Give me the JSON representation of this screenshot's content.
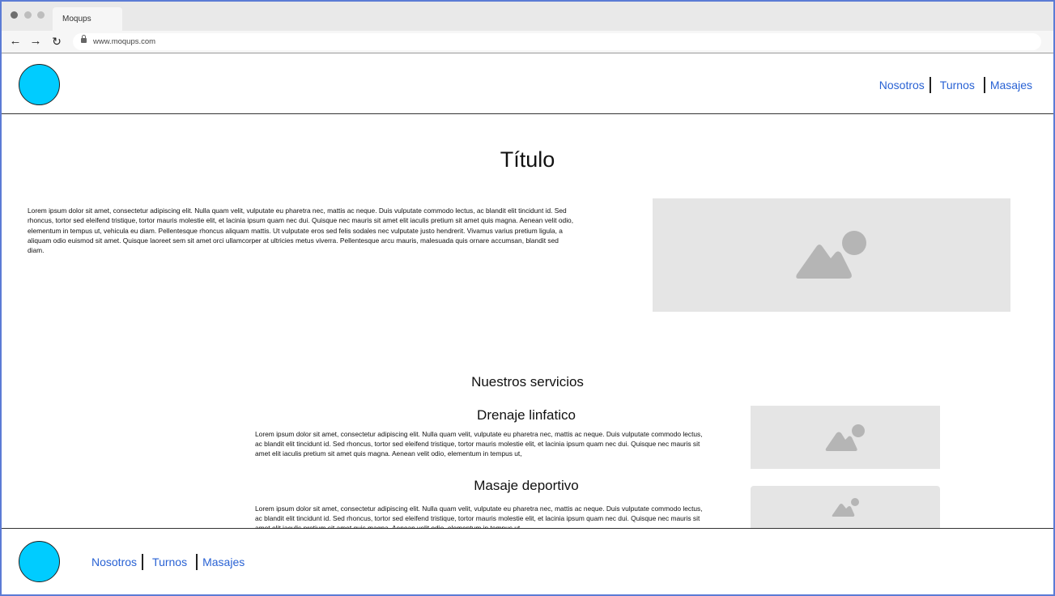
{
  "browser": {
    "tab_title": "Moqups",
    "url": "www.moqups.com"
  },
  "header": {
    "nav": [
      "Nosotros",
      "Turnos",
      "Masajes"
    ]
  },
  "main": {
    "title": "Título",
    "intro_text": "Lorem ipsum dolor sit amet, consectetur adipiscing elit. Nulla quam velit, vulputate eu pharetra nec, mattis ac neque. Duis vulputate commodo lectus, ac blandit elit tincidunt id. Sed rhoncus, tortor sed eleifend tristique, tortor mauris molestie elit, et lacinia ipsum quam nec dui. Quisque nec mauris sit amet elit iaculis pretium sit amet quis magna. Aenean velit odio, elementum in tempus ut, vehicula eu diam. Pellentesque rhoncus aliquam mattis. Ut vulputate eros sed felis sodales nec vulputate justo hendrerit. Vivamus varius pretium ligula, a aliquam odio euismod sit amet. Quisque laoreet sem sit amet orci ullamcorper at ultricies metus viverra. Pellentesque arcu mauris, malesuada quis ornare accumsan, blandit sed diam.",
    "services_heading": "Nuestros servicios",
    "services": [
      {
        "title": "Drenaje linfatico",
        "text": "Lorem ipsum dolor sit amet, consectetur adipiscing elit. Nulla quam velit, vulputate eu pharetra nec, mattis ac neque. Duis vulputate commodo lectus, ac blandit elit tincidunt id. Sed rhoncus, tortor sed eleifend tristique, tortor mauris molestie elit, et lacinia ipsum quam nec dui. Quisque nec mauris sit amet elit iaculis pretium sit amet quis magna. Aenean velit odio, elementum in tempus ut,"
      },
      {
        "title": "Masaje deportivo",
        "text": "Lorem ipsum dolor sit amet, consectetur adipiscing elit. Nulla quam velit, vulputate eu pharetra nec, mattis ac neque. Duis vulputate commodo lectus, ac blandit elit tincidunt id. Sed rhoncus, tortor sed eleifend tristique, tortor mauris molestie elit, et lacinia ipsum quam nec dui. Quisque nec mauris sit amet elit iaculis pretium sit amet quis magna. Aenean velit odio, elementum in tempus ut,"
      }
    ]
  },
  "footer": {
    "nav": [
      "Nosotros",
      "Turnos",
      "Masajes"
    ]
  },
  "colors": {
    "logo": "#00ccff",
    "link": "#2962d4",
    "placeholder_bg": "#e5e5e5",
    "placeholder_icon": "#b5b5b5",
    "frame_border": "#5b7bd5"
  },
  "icons": {
    "back": "arrow-left-icon",
    "forward": "arrow-right-icon",
    "reload": "reload-icon",
    "lock": "lock-icon",
    "image_placeholder": "image-placeholder-icon"
  }
}
